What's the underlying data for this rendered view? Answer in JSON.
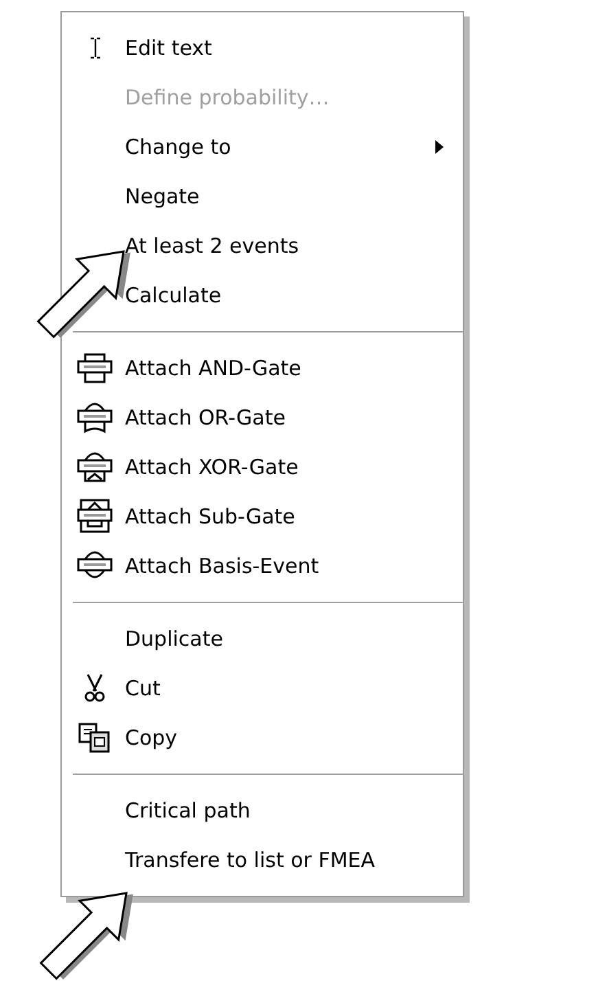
{
  "menu": {
    "groups": [
      {
        "items": [
          {
            "label": "Edit text",
            "kind": "text-cursor",
            "disabled": false,
            "submenu": false
          },
          {
            "label": "Define probability…",
            "kind": "plain",
            "disabled": true,
            "submenu": false
          },
          {
            "label": "Change to",
            "kind": "plain",
            "disabled": false,
            "submenu": true
          },
          {
            "label": "Negate",
            "kind": "plain",
            "disabled": false,
            "submenu": false
          },
          {
            "label": "At least 2 events",
            "kind": "plain",
            "disabled": false,
            "submenu": false
          },
          {
            "label": "Calculate",
            "kind": "plain",
            "disabled": false,
            "submenu": false
          }
        ]
      },
      {
        "items": [
          {
            "label": "Attach AND-Gate",
            "kind": "and-gate",
            "disabled": false,
            "submenu": false
          },
          {
            "label": "Attach OR-Gate",
            "kind": "or-gate",
            "disabled": false,
            "submenu": false
          },
          {
            "label": "Attach XOR-Gate",
            "kind": "xor-gate",
            "disabled": false,
            "submenu": false
          },
          {
            "label": "Attach Sub-Gate",
            "kind": "sub-gate",
            "disabled": false,
            "submenu": false
          },
          {
            "label": "Attach Basis-Event",
            "kind": "basis-event",
            "disabled": false,
            "submenu": false
          }
        ]
      },
      {
        "items": [
          {
            "label": "Duplicate",
            "kind": "plain",
            "disabled": false,
            "submenu": false
          },
          {
            "label": "Cut",
            "kind": "cut",
            "disabled": false,
            "submenu": false
          },
          {
            "label": "Copy",
            "kind": "copy",
            "disabled": false,
            "submenu": false
          }
        ]
      },
      {
        "items": [
          {
            "label": "Critical path",
            "kind": "plain",
            "disabled": false,
            "submenu": false
          },
          {
            "label": "Transfere to list or FMEA",
            "kind": "plain",
            "disabled": false,
            "submenu": false
          }
        ]
      }
    ]
  }
}
